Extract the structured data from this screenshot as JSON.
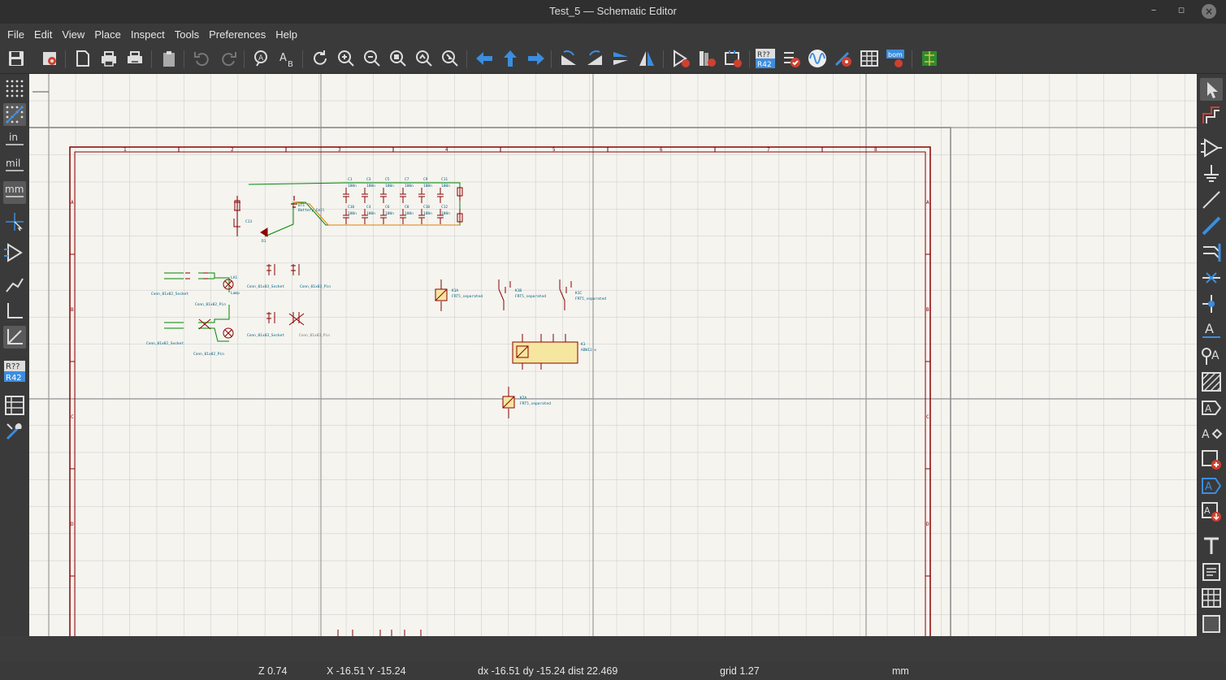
{
  "window": {
    "title": "Test_5 — Schematic Editor"
  },
  "menu": [
    "File",
    "Edit",
    "View",
    "Place",
    "Inspect",
    "Tools",
    "Preferences",
    "Help"
  ],
  "toolbar": {
    "icons": [
      "save-icon",
      "schematic-setup-icon",
      "new-page-icon",
      "print-icon",
      "plot-icon",
      "paste-icon",
      "undo-icon",
      "redo-icon",
      "find-icon",
      "find-replace-icon",
      "refresh-icon",
      "zoom-in-icon",
      "zoom-out-icon",
      "zoom-fit-icon",
      "zoom-objects-icon",
      "zoom-selection-icon",
      "nav-back-icon",
      "nav-up-icon",
      "nav-forward-icon",
      "rotate-ccw-icon",
      "rotate-cw-icon",
      "mirror-v-icon",
      "mirror-h-icon",
      "symbol-editor-icon",
      "symbol-library-icon",
      "footprint-assign-icon",
      "annotate-icon",
      "erc-icon",
      "simulator-icon",
      "bus-definitions-icon",
      "fields-table-icon",
      "bom-icon",
      "pcb-editor-icon"
    ],
    "annotate_top": "R??",
    "annotate_bottom": "R42",
    "bom_label": "bom"
  },
  "left_toolbar": {
    "units": {
      "inch": "in",
      "mil": "mil",
      "mm": "mm"
    },
    "annotate_top": "R??",
    "annotate_bottom": "R42"
  },
  "colors": {
    "frame": "#8b0000",
    "wire": "#008800",
    "component": "#8b0000",
    "label": "#006080",
    "bus": "#e08000",
    "grid": "#b4b4b4"
  },
  "schematic": {
    "border_columns": [
      "1",
      "2",
      "3",
      "4",
      "5",
      "6",
      "7",
      "8"
    ],
    "border_rows": [
      "A",
      "B",
      "C",
      "D"
    ],
    "components": {
      "c1": "C1",
      "c3": "C3",
      "c5": "C5",
      "c7": "C7",
      "c9": "C9",
      "c11": "C11",
      "c1v": "100n",
      "c3v": "100n",
      "c5v": "100n",
      "c7v": "100n",
      "c9v": "100n",
      "c11v": "100n",
      "c10": "C10",
      "c4": "C4",
      "c6": "C6",
      "c8": "C8",
      "c10b": "C10",
      "c12": "C12",
      "c10v": "100n",
      "c4v": "100n",
      "c6v": "100n",
      "c8v": "100n",
      "c10bv": "100n",
      "c12v": "100n",
      "bt1": "BT1",
      "bt1v": "Battery_Cell",
      "d1": "D1",
      "c13": "C13",
      "j1v": "Conn_01x02_Socket",
      "j2v": "Conn_01x02_Pin",
      "lamp": "Lamp",
      "la1": "LA1",
      "j4v": "Conn_01x03_Socket",
      "j5v": "Conn_01x03_Pin",
      "j3v": "Conn_01x02_Socket",
      "j6v": "Conn_01x02_Pin",
      "j7v": "Conn_01x03_Socket",
      "j8v": "Conn_01x03_Pin",
      "k1a": "K1A",
      "k1av": "FRT5_separated",
      "k1b": "K1B",
      "k1bv": "FRT5_separated",
      "k1c": "K1C",
      "k1cv": "FRT5_separated",
      "k1": "K1",
      "k1v": "ADW11-x",
      "k2a": "K2A",
      "k2av": "FRT5_separated"
    }
  },
  "status": {
    "zoom": "Z 0.74",
    "coords": "X -16.51  Y -15.24",
    "delta": "dx -16.51  dy -15.24  dist 22.469",
    "grid": "grid 1.27",
    "units": "mm"
  }
}
